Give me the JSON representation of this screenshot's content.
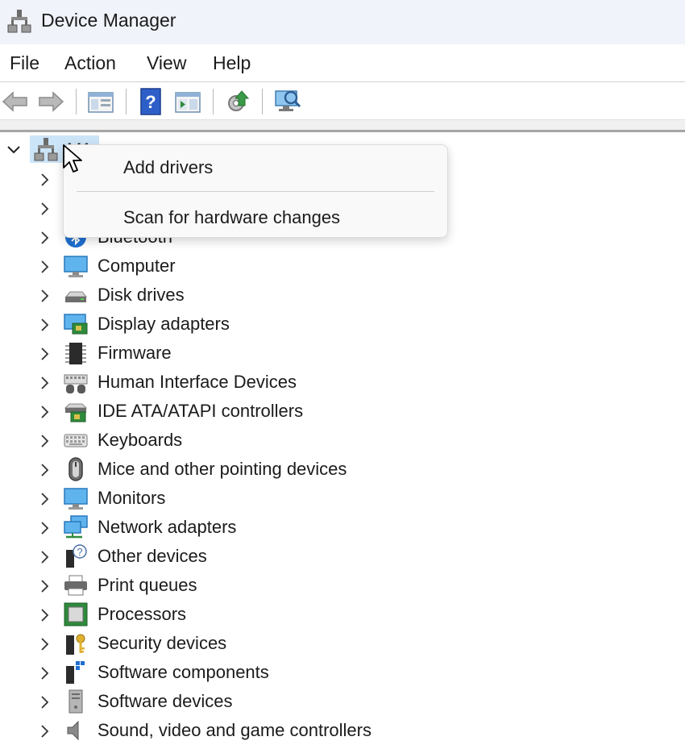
{
  "window": {
    "title": "Device Manager",
    "app_icon": "device-manager-icon"
  },
  "menu": [
    "File",
    "Action",
    "View",
    "Help"
  ],
  "toolbar": [
    "back-arrow-icon",
    "forward-arrow-icon",
    "properties-pane-icon",
    "help-icon",
    "run-pane-icon",
    "update-driver-icon",
    "scan-hardware-icon"
  ],
  "tree": {
    "root_label": "M1",
    "items": [
      {
        "label": "",
        "icon": "hidden-category-icon"
      },
      {
        "label": "",
        "icon": "hidden-category-icon"
      },
      {
        "label": "Bluetooth",
        "icon": "bluetooth-icon"
      },
      {
        "label": "Computer",
        "icon": "computer-monitor-icon"
      },
      {
        "label": "Disk drives",
        "icon": "disk-drive-icon"
      },
      {
        "label": "Display adapters",
        "icon": "display-adapter-icon"
      },
      {
        "label": "Firmware",
        "icon": "firmware-chip-icon"
      },
      {
        "label": "Human Interface Devices",
        "icon": "hid-icon"
      },
      {
        "label": "IDE ATA/ATAPI controllers",
        "icon": "ide-controller-icon"
      },
      {
        "label": "Keyboards",
        "icon": "keyboard-icon"
      },
      {
        "label": "Mice and other pointing devices",
        "icon": "mouse-icon"
      },
      {
        "label": "Monitors",
        "icon": "monitor-icon"
      },
      {
        "label": "Network adapters",
        "icon": "network-adapter-icon"
      },
      {
        "label": "Other devices",
        "icon": "other-devices-icon"
      },
      {
        "label": "Print queues",
        "icon": "printer-icon"
      },
      {
        "label": "Processors",
        "icon": "processor-icon"
      },
      {
        "label": "Security devices",
        "icon": "security-device-icon"
      },
      {
        "label": "Software components",
        "icon": "software-component-icon"
      },
      {
        "label": "Software devices",
        "icon": "software-device-icon"
      },
      {
        "label": "Sound, video and game controllers",
        "icon": "sound-icon"
      }
    ]
  },
  "context_menu": {
    "items": [
      "Add drivers",
      "Scan for hardware changes"
    ]
  },
  "colors": {
    "selection": "#cce4f7",
    "title_bar": "#f0f3f9",
    "accent": "#1a73c8"
  }
}
